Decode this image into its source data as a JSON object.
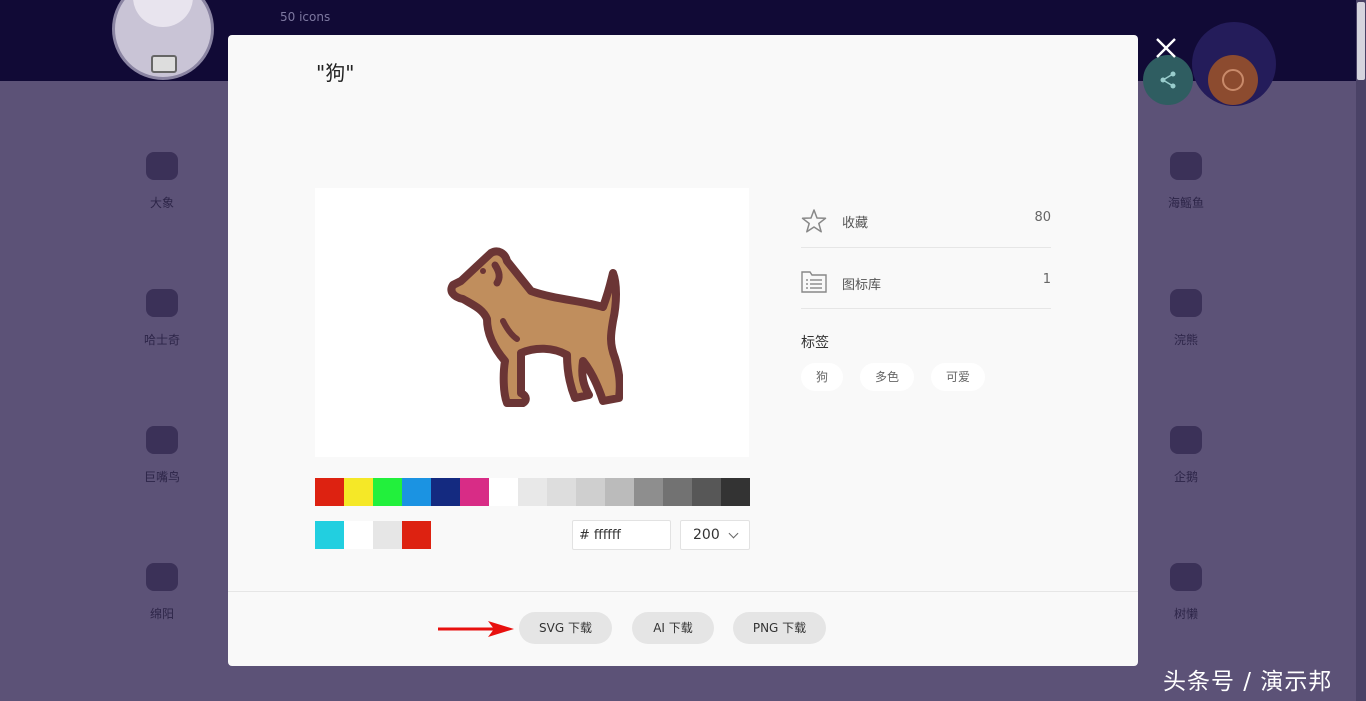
{
  "background": {
    "icon_count": "50 icons",
    "icons": [
      {
        "label": "大象"
      },
      {
        "label": "哈士奇"
      },
      {
        "label": "巨嘴鸟"
      },
      {
        "label": "绵阳"
      },
      {
        "label": "海鳐鱼"
      },
      {
        "label": "浣熊"
      },
      {
        "label": "企鹅"
      },
      {
        "label": "树懒"
      }
    ]
  },
  "modal": {
    "title": "\"狗\"",
    "icon_name": "dog-icon",
    "icon_colors": {
      "body": "#c08e5d",
      "outline": "#6b3535"
    },
    "palette": [
      "#dd2211",
      "#f5e827",
      "#22f03c",
      "#1b93e2",
      "#142a80",
      "#d82c86",
      "#ffffff",
      "#e8e8e8",
      "#dddddd",
      "#cfcfcf",
      "#bbbbbb",
      "#8e8e8e",
      "#727272",
      "#575757",
      "#333333"
    ],
    "recent_colors": [
      "#22cfe0",
      "#ffffff",
      "#e6e6e6",
      "#dd2211"
    ],
    "hex_value": "ffffff",
    "hex_prefix": "#",
    "size_value": "200",
    "favorites_label": "收藏",
    "favorites_count": "80",
    "library_label": "图标库",
    "library_count": "1",
    "tags_title": "标签",
    "tags": [
      "狗",
      "多色",
      "可爱"
    ],
    "buttons": {
      "svg": "SVG 下载",
      "ai": "AI 下载",
      "png": "PNG 下载"
    }
  },
  "watermark": "头条号 / 演示邦"
}
